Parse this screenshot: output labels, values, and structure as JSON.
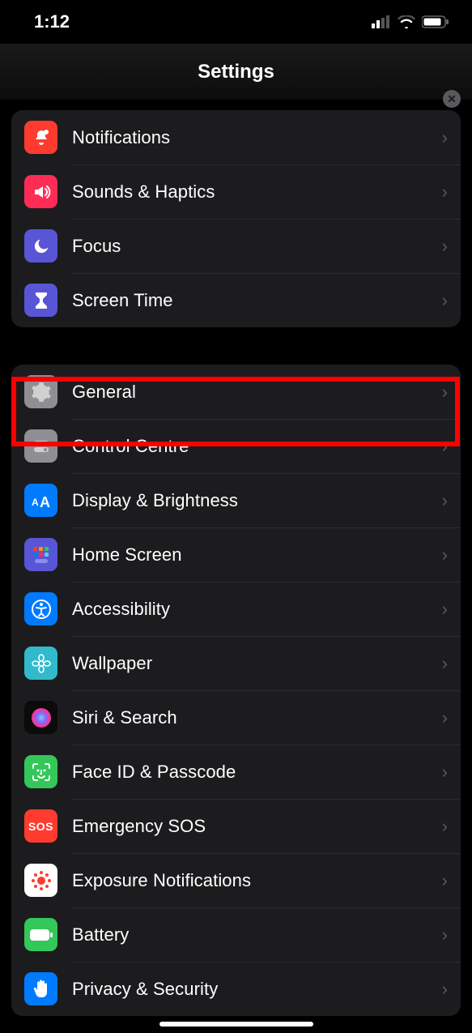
{
  "status": {
    "time": "1:12"
  },
  "header": {
    "title": "Settings",
    "close": "✕"
  },
  "group1": [
    {
      "label": "Notifications"
    },
    {
      "label": "Sounds & Haptics"
    },
    {
      "label": "Focus"
    },
    {
      "label": "Screen Time"
    }
  ],
  "group2": [
    {
      "label": "General"
    },
    {
      "label": "Control Centre"
    },
    {
      "label": "Display & Brightness"
    },
    {
      "label": "Home Screen"
    },
    {
      "label": "Accessibility"
    },
    {
      "label": "Wallpaper"
    },
    {
      "label": "Siri & Search"
    },
    {
      "label": "Face ID & Passcode"
    },
    {
      "label": "Emergency SOS"
    },
    {
      "label": "Exposure Notifications"
    },
    {
      "label": "Battery"
    },
    {
      "label": "Privacy & Security"
    }
  ],
  "sos_text": "SOS"
}
